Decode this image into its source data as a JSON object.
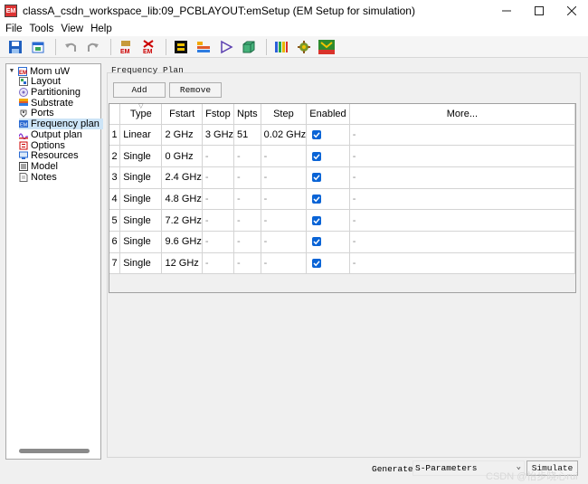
{
  "window": {
    "title": "classA_csdn_workspace_lib:09_PCBLAYOUT:emSetup (EM Setup for simulation)",
    "app_icon_text": "EM",
    "controls": [
      "minimize-icon",
      "maximize-icon",
      "close-icon"
    ]
  },
  "menubar": {
    "items": [
      "File",
      "Tools",
      "View",
      "Help"
    ]
  },
  "toolbar": {
    "icons": [
      "save-icon",
      "open-icon",
      "undo-icon",
      "redo-icon",
      "em-setup-icon",
      "em-remove-icon",
      "component-icon",
      "layer-stack-icon",
      "play-icon",
      "3d-box-icon",
      "color-bars-icon",
      "settings-gear-icon",
      "mesh-view-icon"
    ]
  },
  "tree": {
    "root": "Mom uW",
    "items": [
      {
        "label": "Layout",
        "icon": "layout-icon"
      },
      {
        "label": "Partitioning",
        "icon": "partitioning-icon"
      },
      {
        "label": "Substrate",
        "icon": "substrate-icon"
      },
      {
        "label": "Ports",
        "icon": "ports-icon"
      },
      {
        "label": "Frequency plan",
        "icon": "frequency-plan-icon"
      },
      {
        "label": "Output plan",
        "icon": "output-plan-icon"
      },
      {
        "label": "Options",
        "icon": "options-icon"
      },
      {
        "label": "Resources",
        "icon": "resources-icon"
      },
      {
        "label": "Model",
        "icon": "model-icon"
      },
      {
        "label": "Notes",
        "icon": "notes-icon"
      }
    ],
    "selected": "Frequency plan"
  },
  "frequency_plan": {
    "title": "Frequency Plan",
    "add_label": "Add",
    "remove_label": "Remove",
    "columns": [
      "Type",
      "Fstart",
      "Fstop",
      "Npts",
      "Step",
      "Enabled",
      "More..."
    ],
    "rows": [
      {
        "num": "1",
        "type": "Linear",
        "fstart": "2 GHz",
        "fstop": "3 GHz",
        "npts": "51",
        "step": "0.02 GHz",
        "enabled": true,
        "more": "-"
      },
      {
        "num": "2",
        "type": "Single",
        "fstart": "0 GHz",
        "fstop": "-",
        "npts": "-",
        "step": "-",
        "enabled": true,
        "more": "-"
      },
      {
        "num": "3",
        "type": "Single",
        "fstart": "2.4 GHz",
        "fstop": "-",
        "npts": "-",
        "step": "-",
        "enabled": true,
        "more": "-"
      },
      {
        "num": "4",
        "type": "Single",
        "fstart": "4.8 GHz",
        "fstop": "-",
        "npts": "-",
        "step": "-",
        "enabled": true,
        "more": "-"
      },
      {
        "num": "5",
        "type": "Single",
        "fstart": "7.2 GHz",
        "fstop": "-",
        "npts": "-",
        "step": "-",
        "enabled": true,
        "more": "-"
      },
      {
        "num": "6",
        "type": "Single",
        "fstart": "9.6 GHz",
        "fstop": "-",
        "npts": "-",
        "step": "-",
        "enabled": true,
        "more": "-"
      },
      {
        "num": "7",
        "type": "Single",
        "fstart": "12 GHz",
        "fstop": "-",
        "npts": "-",
        "step": "-",
        "enabled": true,
        "more": "-"
      }
    ]
  },
  "footer": {
    "generate_label": "Generate:",
    "generate_value": "S-Parameters",
    "simulate_label": "Simulate",
    "watermark": "CSDN @怡步晓心rui"
  },
  "colors": {
    "selection": "#cce4f7",
    "checkbox": "#0a64d6",
    "grid_line": "#d4d4d4"
  }
}
